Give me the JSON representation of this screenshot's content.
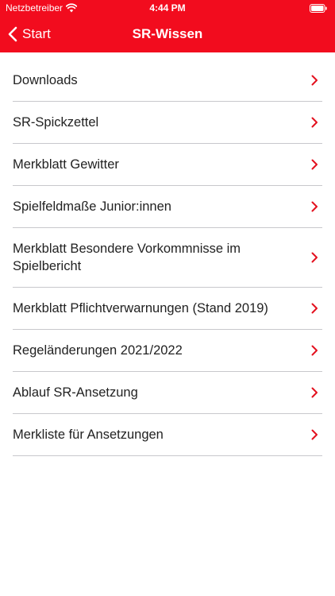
{
  "status_bar": {
    "carrier": "Netzbetreiber",
    "time": "4:44 PM"
  },
  "nav": {
    "back_label": "Start",
    "title": "SR-Wissen"
  },
  "colors": {
    "brand_red": "#f20c1e",
    "chevron_red": "#e3101e"
  },
  "items": [
    {
      "label": "Downloads"
    },
    {
      "label": "SR-Spickzettel"
    },
    {
      "label": "Merkblatt Gewitter"
    },
    {
      "label": "Spielfeldmaße Junior:innen"
    },
    {
      "label": "Merkblatt Besondere Vorkommnisse im Spielbericht"
    },
    {
      "label": "Merkblatt Pflichtverwarnungen (Stand 2019)"
    },
    {
      "label": "Regeländerungen 2021/2022"
    },
    {
      "label": "Ablauf SR-Ansetzung"
    },
    {
      "label": "Merkliste für Ansetzungen"
    }
  ]
}
